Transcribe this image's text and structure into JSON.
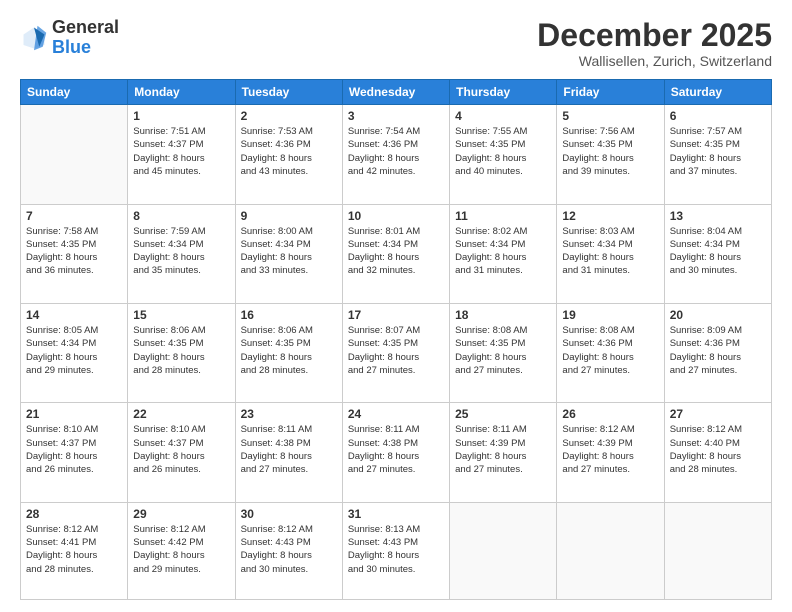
{
  "header": {
    "logo_general": "General",
    "logo_blue": "Blue",
    "month": "December 2025",
    "location": "Wallisellen, Zurich, Switzerland"
  },
  "weekdays": [
    "Sunday",
    "Monday",
    "Tuesday",
    "Wednesday",
    "Thursday",
    "Friday",
    "Saturday"
  ],
  "weeks": [
    [
      {
        "day": "",
        "info": ""
      },
      {
        "day": "1",
        "info": "Sunrise: 7:51 AM\nSunset: 4:37 PM\nDaylight: 8 hours\nand 45 minutes."
      },
      {
        "day": "2",
        "info": "Sunrise: 7:53 AM\nSunset: 4:36 PM\nDaylight: 8 hours\nand 43 minutes."
      },
      {
        "day": "3",
        "info": "Sunrise: 7:54 AM\nSunset: 4:36 PM\nDaylight: 8 hours\nand 42 minutes."
      },
      {
        "day": "4",
        "info": "Sunrise: 7:55 AM\nSunset: 4:35 PM\nDaylight: 8 hours\nand 40 minutes."
      },
      {
        "day": "5",
        "info": "Sunrise: 7:56 AM\nSunset: 4:35 PM\nDaylight: 8 hours\nand 39 minutes."
      },
      {
        "day": "6",
        "info": "Sunrise: 7:57 AM\nSunset: 4:35 PM\nDaylight: 8 hours\nand 37 minutes."
      }
    ],
    [
      {
        "day": "7",
        "info": "Sunrise: 7:58 AM\nSunset: 4:35 PM\nDaylight: 8 hours\nand 36 minutes."
      },
      {
        "day": "8",
        "info": "Sunrise: 7:59 AM\nSunset: 4:34 PM\nDaylight: 8 hours\nand 35 minutes."
      },
      {
        "day": "9",
        "info": "Sunrise: 8:00 AM\nSunset: 4:34 PM\nDaylight: 8 hours\nand 33 minutes."
      },
      {
        "day": "10",
        "info": "Sunrise: 8:01 AM\nSunset: 4:34 PM\nDaylight: 8 hours\nand 32 minutes."
      },
      {
        "day": "11",
        "info": "Sunrise: 8:02 AM\nSunset: 4:34 PM\nDaylight: 8 hours\nand 31 minutes."
      },
      {
        "day": "12",
        "info": "Sunrise: 8:03 AM\nSunset: 4:34 PM\nDaylight: 8 hours\nand 31 minutes."
      },
      {
        "day": "13",
        "info": "Sunrise: 8:04 AM\nSunset: 4:34 PM\nDaylight: 8 hours\nand 30 minutes."
      }
    ],
    [
      {
        "day": "14",
        "info": "Sunrise: 8:05 AM\nSunset: 4:34 PM\nDaylight: 8 hours\nand 29 minutes."
      },
      {
        "day": "15",
        "info": "Sunrise: 8:06 AM\nSunset: 4:35 PM\nDaylight: 8 hours\nand 28 minutes."
      },
      {
        "day": "16",
        "info": "Sunrise: 8:06 AM\nSunset: 4:35 PM\nDaylight: 8 hours\nand 28 minutes."
      },
      {
        "day": "17",
        "info": "Sunrise: 8:07 AM\nSunset: 4:35 PM\nDaylight: 8 hours\nand 27 minutes."
      },
      {
        "day": "18",
        "info": "Sunrise: 8:08 AM\nSunset: 4:35 PM\nDaylight: 8 hours\nand 27 minutes."
      },
      {
        "day": "19",
        "info": "Sunrise: 8:08 AM\nSunset: 4:36 PM\nDaylight: 8 hours\nand 27 minutes."
      },
      {
        "day": "20",
        "info": "Sunrise: 8:09 AM\nSunset: 4:36 PM\nDaylight: 8 hours\nand 27 minutes."
      }
    ],
    [
      {
        "day": "21",
        "info": "Sunrise: 8:10 AM\nSunset: 4:37 PM\nDaylight: 8 hours\nand 26 minutes."
      },
      {
        "day": "22",
        "info": "Sunrise: 8:10 AM\nSunset: 4:37 PM\nDaylight: 8 hours\nand 26 minutes."
      },
      {
        "day": "23",
        "info": "Sunrise: 8:11 AM\nSunset: 4:38 PM\nDaylight: 8 hours\nand 27 minutes."
      },
      {
        "day": "24",
        "info": "Sunrise: 8:11 AM\nSunset: 4:38 PM\nDaylight: 8 hours\nand 27 minutes."
      },
      {
        "day": "25",
        "info": "Sunrise: 8:11 AM\nSunset: 4:39 PM\nDaylight: 8 hours\nand 27 minutes."
      },
      {
        "day": "26",
        "info": "Sunrise: 8:12 AM\nSunset: 4:39 PM\nDaylight: 8 hours\nand 27 minutes."
      },
      {
        "day": "27",
        "info": "Sunrise: 8:12 AM\nSunset: 4:40 PM\nDaylight: 8 hours\nand 28 minutes."
      }
    ],
    [
      {
        "day": "28",
        "info": "Sunrise: 8:12 AM\nSunset: 4:41 PM\nDaylight: 8 hours\nand 28 minutes."
      },
      {
        "day": "29",
        "info": "Sunrise: 8:12 AM\nSunset: 4:42 PM\nDaylight: 8 hours\nand 29 minutes."
      },
      {
        "day": "30",
        "info": "Sunrise: 8:12 AM\nSunset: 4:43 PM\nDaylight: 8 hours\nand 30 minutes."
      },
      {
        "day": "31",
        "info": "Sunrise: 8:13 AM\nSunset: 4:43 PM\nDaylight: 8 hours\nand 30 minutes."
      },
      {
        "day": "",
        "info": ""
      },
      {
        "day": "",
        "info": ""
      },
      {
        "day": "",
        "info": ""
      }
    ]
  ]
}
